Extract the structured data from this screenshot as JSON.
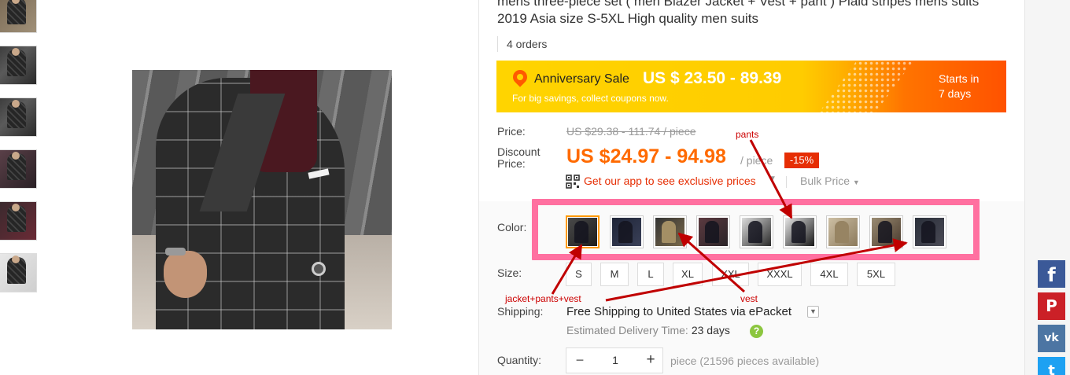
{
  "product": {
    "title": "mens three-piece set ( men Blazer Jacket + Vest + pant ) Plaid stripes mens suits 2019 Asia size S-5XL High quality men suits",
    "orders": "4 orders"
  },
  "gallery": {
    "thumbnails": [
      "thumb-1",
      "thumb-2",
      "thumb-3",
      "thumb-4",
      "thumb-5",
      "thumb-6"
    ]
  },
  "banner": {
    "icon": "location-pin-icon",
    "name": "Anniversary Sale",
    "price": "US $ 23.50 - 89.39",
    "subtitle": "For big savings, collect coupons now.",
    "starts_label": "Starts in",
    "starts_value": "7 days",
    "colors": {
      "yellow": "#ffd400",
      "orange": "#ff5200"
    }
  },
  "pricing": {
    "price_label": "Price:",
    "original": "US $29.38 - 111.74 / piece",
    "discount_label_1": "Discount",
    "discount_label_2": "Price:",
    "discount": "US $24.97 - 94.98",
    "per_unit": "/ piece",
    "badge": "-15%",
    "app_text": "Get our app to see exclusive prices",
    "bulk": "Bulk Price",
    "accent_color": "#ff6a00"
  },
  "color": {
    "label": "Color:",
    "selected_index": 0,
    "swatches": [
      "color-1",
      "color-2",
      "color-3",
      "color-4",
      "color-5",
      "color-6",
      "color-7",
      "color-8",
      "color-9"
    ]
  },
  "size": {
    "label": "Size:",
    "options": [
      "S",
      "M",
      "L",
      "XL",
      "XXL",
      "XXXL",
      "4XL",
      "5XL"
    ]
  },
  "annotations": {
    "pants": "pants",
    "vest": "vest",
    "set": "jacket+pants+vest",
    "highlight_color": "#ff70a0",
    "arrow_color": "#c00000"
  },
  "shipping": {
    "label": "Shipping:",
    "prefix": "Free Shipping to",
    "destination": "United States via ePacket",
    "est_label": "Estimated Delivery Time:",
    "est_days": "23 days"
  },
  "quantity": {
    "label": "Quantity:",
    "value": "1",
    "minus": "−",
    "plus": "+",
    "available": "piece (21596 pieces available)"
  },
  "social": {
    "facebook": "f",
    "pinterest": "P",
    "vk": "vk",
    "twitter": "t"
  }
}
